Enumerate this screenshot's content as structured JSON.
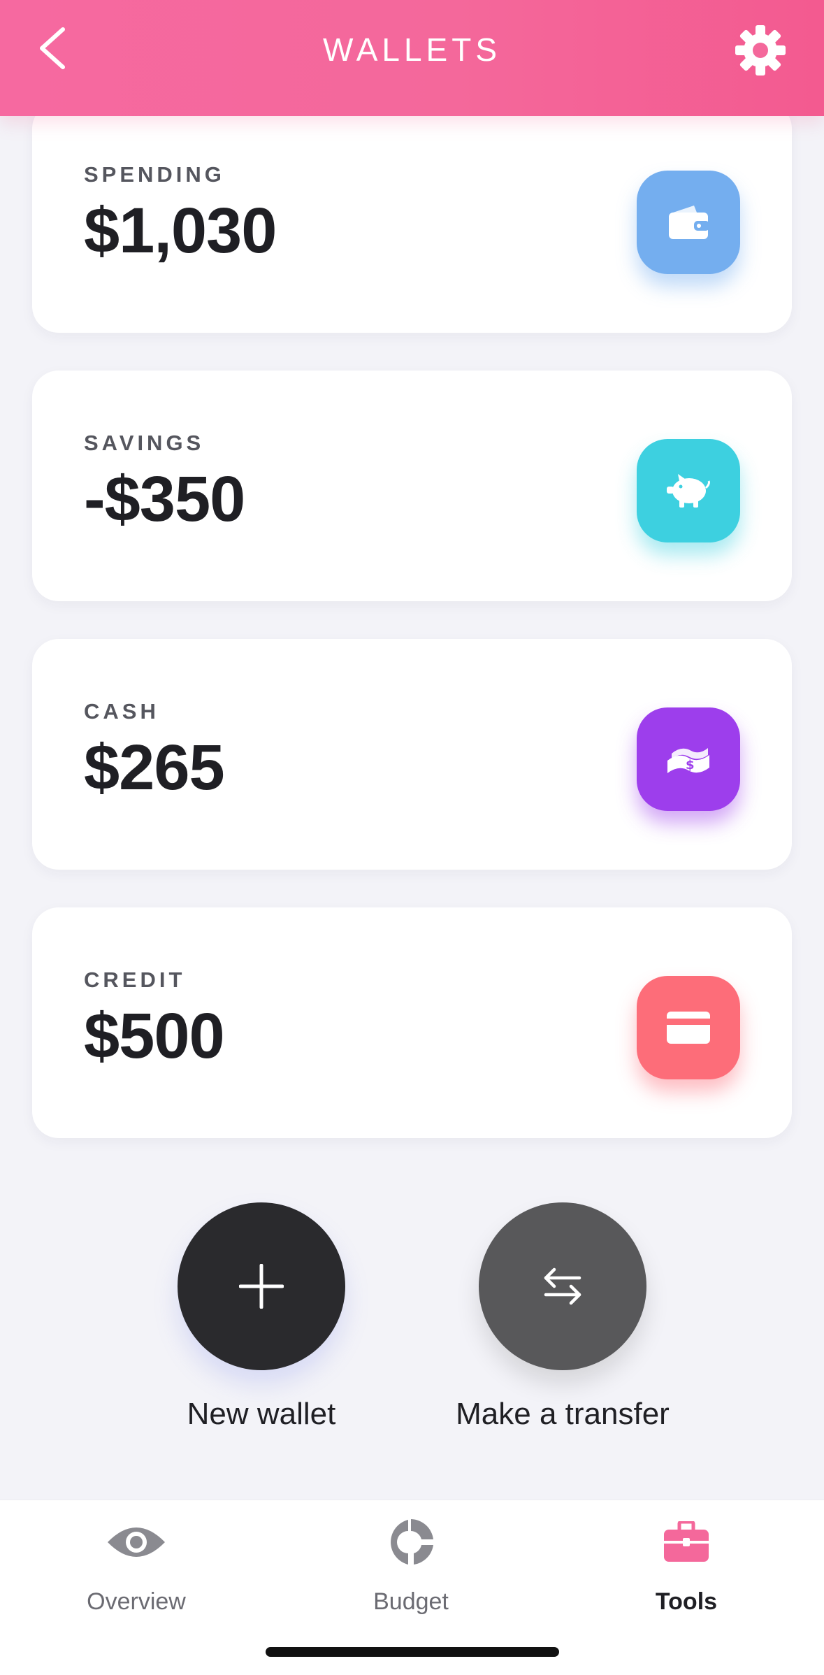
{
  "header": {
    "title": "WALLETS",
    "color": "#f4689b"
  },
  "wallets": [
    {
      "label": "SPENDING",
      "amount": "$1,030",
      "icon": "wallet-icon",
      "color": "#74aeef"
    },
    {
      "label": "SAVINGS",
      "amount": "-$350",
      "icon": "piggy-bank-icon",
      "color": "#3dd0e0"
    },
    {
      "label": "CASH",
      "amount": "$265",
      "icon": "cash-icon",
      "color": "#9d3eec"
    },
    {
      "label": "CREDIT",
      "amount": "$500",
      "icon": "credit-card-icon",
      "color": "#fd6d79"
    }
  ],
  "actions": {
    "new_wallet": "New wallet",
    "transfer": "Make a transfer"
  },
  "tabs": [
    {
      "label": "Overview",
      "icon": "eye-icon",
      "active": false
    },
    {
      "label": "Budget",
      "icon": "donut-chart-icon",
      "active": false
    },
    {
      "label": "Tools",
      "icon": "toolbox-icon",
      "active": true,
      "color": "#f4689b"
    }
  ]
}
